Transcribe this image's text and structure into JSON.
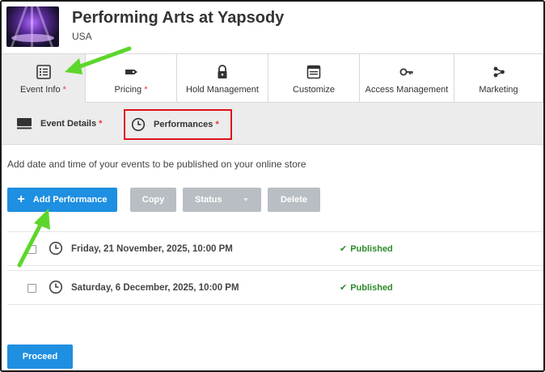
{
  "header": {
    "title": "Performing Arts at Yapsody",
    "subtitle": "USA",
    "thumbnail_icon": "event-image"
  },
  "tabs": [
    {
      "label": "Event Info",
      "required": "*",
      "icon": "list-icon"
    },
    {
      "label": "Pricing",
      "required": "*",
      "icon": "tag-icon"
    },
    {
      "label": "Hold Management",
      "required": "",
      "icon": "lock-icon"
    },
    {
      "label": "Customize",
      "required": "",
      "icon": "browser-window-icon"
    },
    {
      "label": "Access Management",
      "required": "",
      "icon": "key-icon"
    },
    {
      "label": "Marketing",
      "required": "",
      "icon": "share-icon"
    }
  ],
  "subtabs": {
    "details": {
      "label": "Event Details",
      "required": "*",
      "icon": "monitor-icon"
    },
    "performances": {
      "label": "Performances",
      "required": "*",
      "icon": "clock-icon"
    }
  },
  "description": "Add date and time of your events to be published on your online store",
  "toolbar": {
    "add_label": "Add Performance",
    "copy_label": "Copy",
    "status_label": "Status",
    "delete_label": "Delete"
  },
  "performances": [
    {
      "date": "Friday, 21 November, 2025, 10:00 PM",
      "status": "Published"
    },
    {
      "date": "Saturday, 6 December, 2025, 10:00 PM",
      "status": "Published"
    }
  ],
  "proceed_label": "Proceed",
  "colors": {
    "primary": "#1e8fe1",
    "disabled": "#b9bec4",
    "published": "#2e8b2e",
    "required": "#e53935",
    "highlight": "#e0101a",
    "annotation_arrow": "#5dd62c"
  }
}
